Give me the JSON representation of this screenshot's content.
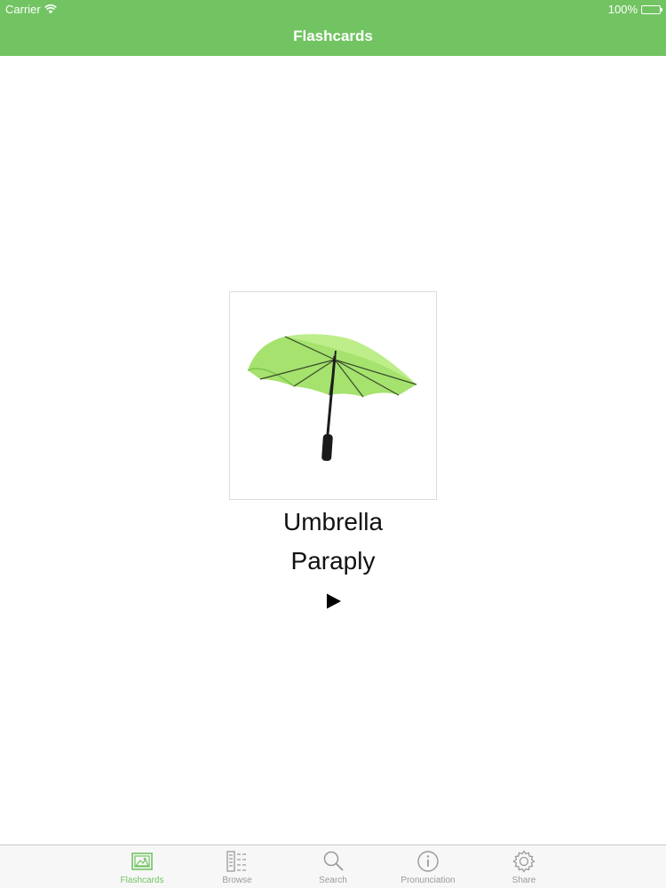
{
  "status_bar": {
    "carrier": "Carrier",
    "battery": "100%"
  },
  "nav": {
    "title": "Flashcards"
  },
  "card": {
    "image": "umbrella",
    "word": "Umbrella",
    "translation": "Paraply",
    "play": "play-icon"
  },
  "tabs": [
    {
      "label": "Flashcards",
      "icon": "image-icon",
      "active": true
    },
    {
      "label": "Browse",
      "icon": "list-icon",
      "active": false
    },
    {
      "label": "Search",
      "icon": "search-icon",
      "active": false
    },
    {
      "label": "Pronunciation",
      "icon": "info-icon",
      "active": false
    },
    {
      "label": "Share",
      "icon": "gear-icon",
      "active": false
    }
  ],
  "colors": {
    "accent": "#72c462",
    "tab_inactive": "#9a9a9a"
  }
}
